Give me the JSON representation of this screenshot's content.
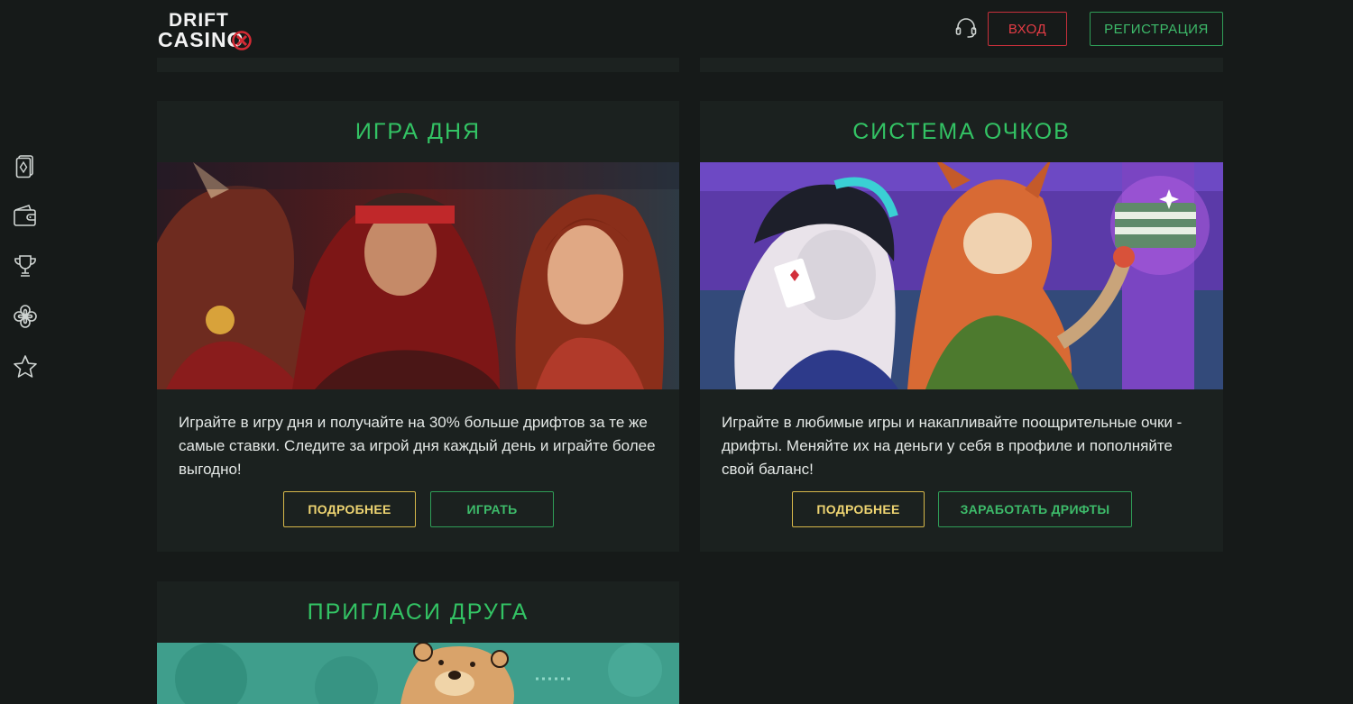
{
  "header": {
    "logo_line1": "DRIFT",
    "logo_line2": "CASINO",
    "login_label": "ВХОД",
    "register_label": "РЕГИСТРАЦИЯ"
  },
  "sidebar": {
    "items": [
      {
        "icon": "cards-icon"
      },
      {
        "icon": "wallet-icon"
      },
      {
        "icon": "trophy-icon"
      },
      {
        "icon": "clover-icon"
      },
      {
        "icon": "star-icon"
      }
    ]
  },
  "cards": [
    {
      "title": "ИГРА ДНЯ",
      "text": "Играйте в игру дня и получайте на 30% больше дрифтов за те же самые ставки. Следите за игрой дня каждый день и играйте более выгодно!",
      "button_more": "ПОДРОБНЕЕ",
      "button_action": "ИГРАТЬ"
    },
    {
      "title": "СИСТЕМА ОЧКОВ",
      "text": "Играйте в любимые игры и накапливайте поощрительные очки - дрифты. Меняйте их на деньги у себя в профиле и пополняйте свой баланс!",
      "button_more": "ПОДРОБНЕЕ",
      "button_action": "ЗАРАБОТАТЬ ДРИФТЫ"
    },
    {
      "title": "ПРИГЛАСИ ДРУГА"
    }
  ],
  "colors": {
    "accent_green": "#33c364",
    "accent_red": "#e33c45",
    "accent_gold": "#efd572",
    "background": "#161a19",
    "card": "#1b211f"
  }
}
